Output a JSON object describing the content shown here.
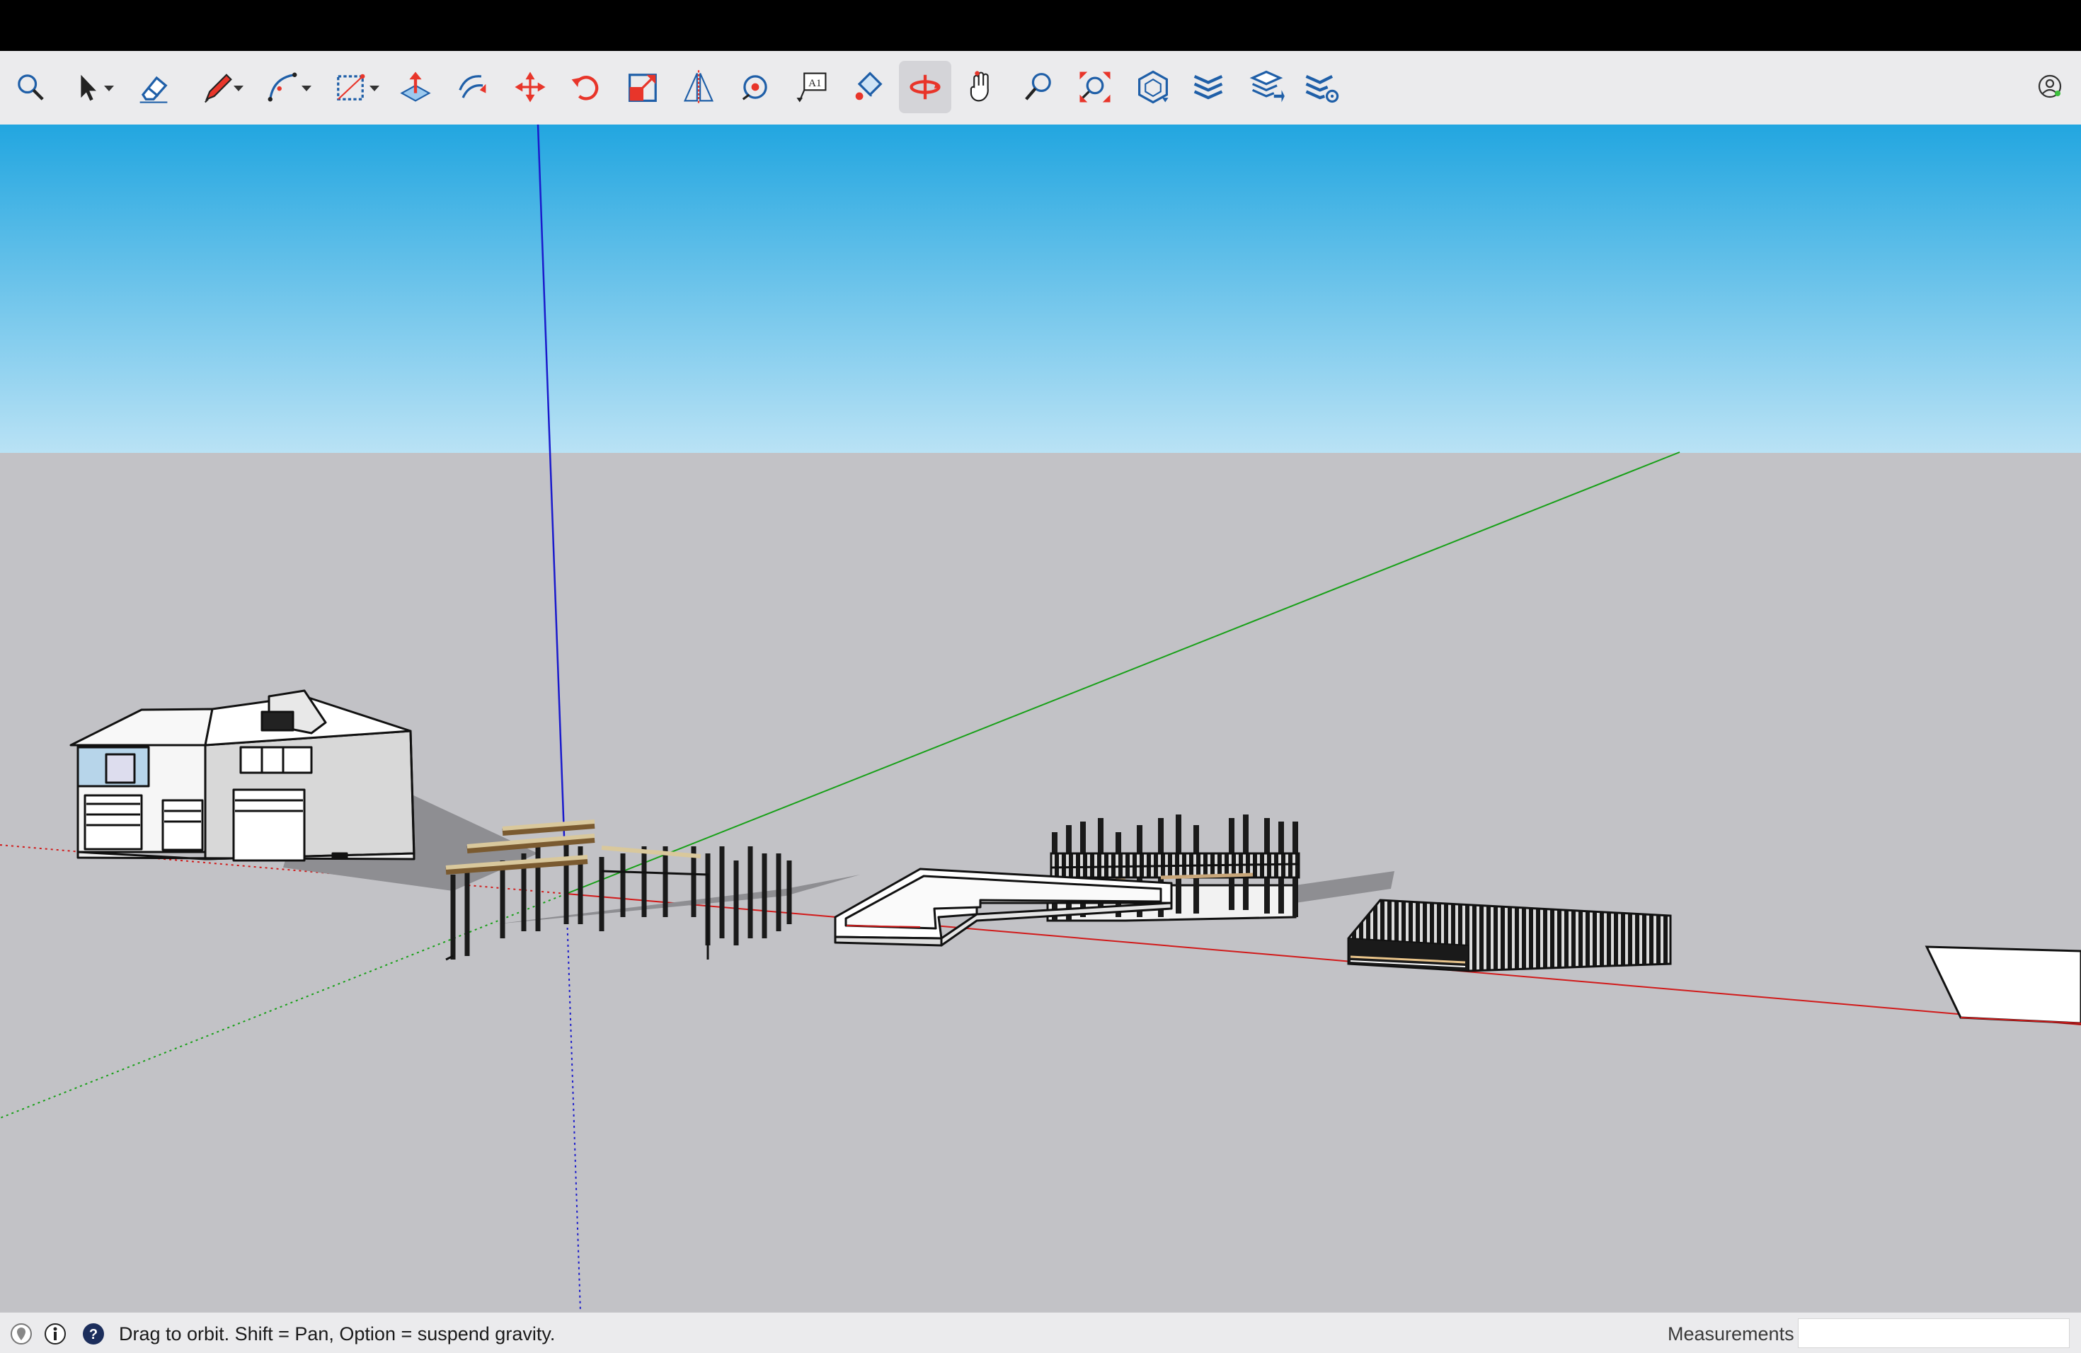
{
  "status": {
    "hint": "Drag to orbit. Shift = Pan, Option = suspend gravity.",
    "measurements_label": "Measurements",
    "measurements_value": ""
  },
  "toolbar": {
    "tools": [
      {
        "name": "search-icon",
        "active": false
      },
      {
        "name": "select-tool-icon",
        "active": false,
        "dropdown": true
      },
      {
        "name": "eraser-icon",
        "active": false
      },
      {
        "name": "line-tool-icon",
        "active": false,
        "dropdown": true
      },
      {
        "name": "arc-tool-icon",
        "active": false,
        "dropdown": true
      },
      {
        "name": "rectangle-tool-icon",
        "active": false,
        "dropdown": true
      },
      {
        "name": "push-pull-icon",
        "active": false
      },
      {
        "name": "offset-icon",
        "active": false
      },
      {
        "name": "move-icon",
        "active": false
      },
      {
        "name": "rotate-icon",
        "active": false
      },
      {
        "name": "scale-icon",
        "active": false
      },
      {
        "name": "flip-icon",
        "active": false
      },
      {
        "name": "tape-measure-icon",
        "active": false
      },
      {
        "name": "text-label-icon",
        "active": false
      },
      {
        "name": "paint-bucket-icon",
        "active": false
      },
      {
        "name": "orbit-icon",
        "active": true
      },
      {
        "name": "pan-icon",
        "active": false
      },
      {
        "name": "zoom-icon",
        "active": false
      },
      {
        "name": "zoom-extents-icon",
        "active": false
      },
      {
        "name": "3d-warehouse-icon",
        "active": false
      },
      {
        "name": "extension-warehouse-icon",
        "active": false
      },
      {
        "name": "layout-send-icon",
        "active": false
      },
      {
        "name": "extension-manager-icon",
        "active": false
      }
    ],
    "account": {
      "name": "account-icon"
    }
  },
  "colors": {
    "sky_top": "#22a6e0",
    "sky_bottom": "#b9e2f5",
    "ground": "#c2c2c6",
    "axis_red": "#d11a1a",
    "axis_green": "#18a018",
    "axis_blue": "#1a1acc",
    "active_tool": "#e8352a",
    "tool_blue": "#1f5fa8"
  }
}
